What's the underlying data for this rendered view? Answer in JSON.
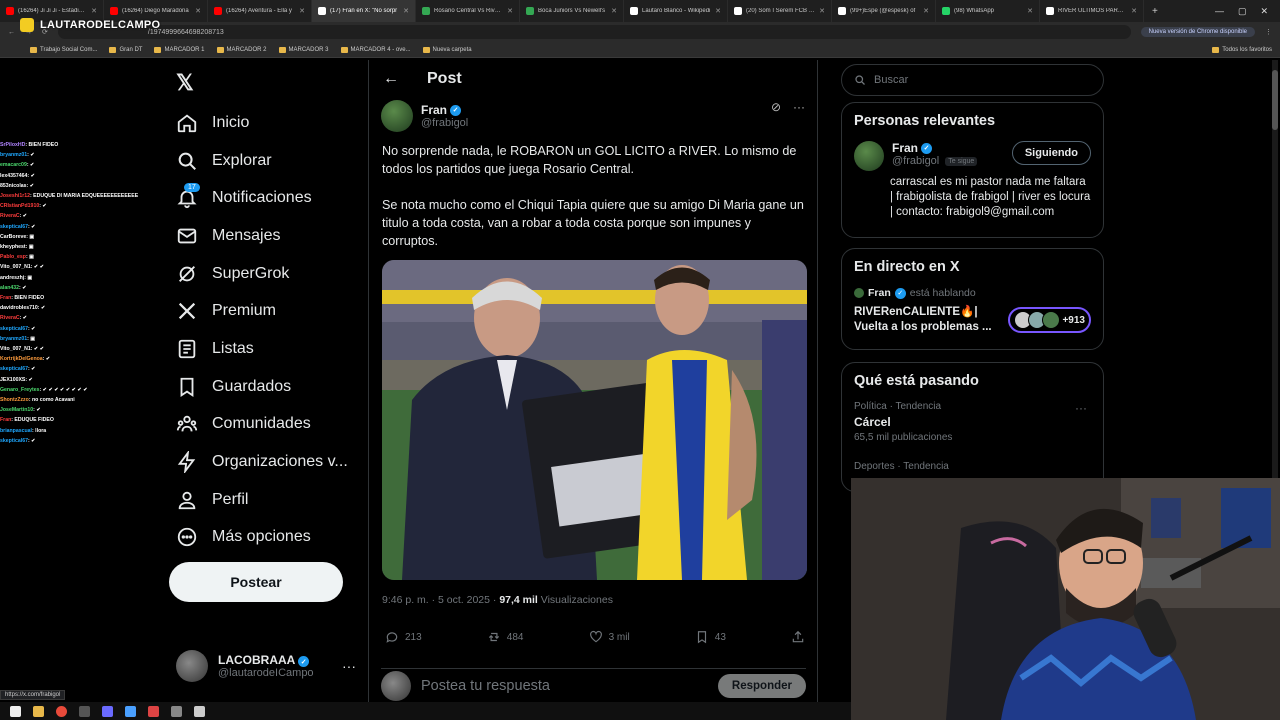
{
  "browser": {
    "tabs": [
      {
        "label": "(16264) Ji Ji Ji - Estadio U",
        "color": "#ff0000"
      },
      {
        "label": "(16264) Diego Maradona",
        "color": "#ff0000"
      },
      {
        "label": "(16264) Aventura - Ella y",
        "color": "#ff0000"
      },
      {
        "label": "(17) Fran en X: \"No sorpr",
        "color": "#ffffff",
        "active": true
      },
      {
        "label": "Rosario Central Vs River P",
        "color": "#34a853"
      },
      {
        "label": "Boca Juniors Vs Newell's",
        "color": "#34a853"
      },
      {
        "label": "Lautaro Blanco - Wikipedi",
        "color": "#ffffff"
      },
      {
        "label": "(20) Som I Serem FCB en",
        "color": "#ffffff"
      },
      {
        "label": "(99+)Espe (@espesk) of",
        "color": "#ffffff"
      },
      {
        "label": "(98) WhatsApp",
        "color": "#25d366"
      },
      {
        "label": "RIVER ULTIMOS PARTIDO",
        "color": "#ffffff"
      }
    ],
    "url": "/1974999664698208713",
    "chrome_update": "Nueva versión de Chrome disponible",
    "bookmarks": [
      "Trabajo Social Com...",
      "Gran DT",
      "MARCADOR 1",
      "MARCADOR 2",
      "MARCADOR 3",
      "MARCADOR 4 - ove...",
      "Nueva carpeta"
    ],
    "bookmarks_right": "Todos los favoritos",
    "status_url": "https://x.com/frabigol"
  },
  "overlay": {
    "logo": "LAUTARODELCAMPO"
  },
  "chat": [
    {
      "user": "SrPiloxHD",
      "msg": ": BIEN FIDEO",
      "color": "#b084ff"
    },
    {
      "user": "bryanmz01",
      "msg": ": ✔",
      "color": "#1fa8ff"
    },
    {
      "user": "emacarc09",
      "msg": ": ✔",
      "color": "#4cd96e"
    },
    {
      "user": "lex4357464",
      "msg": ": ✔",
      "color": "#ffffff"
    },
    {
      "user": "853nicolas",
      "msg": ": ✔",
      "color": "#ffffff"
    },
    {
      "user": "Joseshi1r12",
      "msg": ": EDUQUE DI MARIA EDQUEEEEEEEEEEEE",
      "color": "#ff3d3d"
    },
    {
      "user": "CRIstianPd1910",
      "msg": ": ✔",
      "color": "#ff3d3d"
    },
    {
      "user": "RiveraC",
      "msg": ": ✔",
      "color": "#ff3d3d"
    },
    {
      "user": "skeptical67",
      "msg": ": ✔",
      "color": "#1fa8ff"
    },
    {
      "user": "CarBoreve",
      "msg": ": ▣",
      "color": "#ffffff"
    },
    {
      "user": "kheyphest",
      "msg": ": ▣",
      "color": "#ffffff"
    },
    {
      "user": "Pablo_esp",
      "msg": ": ▣",
      "color": "#ff3d3d"
    },
    {
      "user": "Vito_007_N1",
      "msg": ": ✔ ✔",
      "color": "#ffffff"
    },
    {
      "user": "andreszhj",
      "msg": ": ▣",
      "color": "#ffffff"
    },
    {
      "user": "alan432",
      "msg": ": ✔",
      "color": "#4cd96e"
    },
    {
      "user": "Fran",
      "msg": ": BIEN FIDEO",
      "color": "#ff3d3d"
    },
    {
      "user": "davidrobles710",
      "msg": ": ✔",
      "color": "#ffffff"
    },
    {
      "user": "RiveraC",
      "msg": ": ✔",
      "color": "#ff3d3d"
    },
    {
      "user": "skeptical67",
      "msg": ": ✔",
      "color": "#1fa8ff"
    },
    {
      "user": "bryanmz01",
      "msg": ": ▣",
      "color": "#1fa8ff"
    },
    {
      "user": "Vito_007_N1",
      "msg": ": ✔ ✔",
      "color": "#ffffff"
    },
    {
      "user": "KortrijkDelGenoa",
      "msg": ": ✔",
      "color": "#ff9c3d"
    },
    {
      "user": "skeptical67",
      "msg": ": ✔",
      "color": "#1fa8ff"
    },
    {
      "user": "JEX100XS",
      "msg": ": ✔",
      "color": "#ffffff"
    },
    {
      "user": "Genaro_Freytes",
      "msg": ": ✔ ✔ ✔ ✔ ✔ ✔ ✔ ✔",
      "color": "#4cd96e"
    },
    {
      "user": "ShontzZzzo",
      "msg": ": no como Acavani",
      "color": "#ff9c3d"
    },
    {
      "user": "JoseMartin10",
      "msg": ": ✔",
      "color": "#4cd96e"
    },
    {
      "user": "Fran",
      "msg": ": EDUQUE FIDEO",
      "color": "#ff3d3d"
    },
    {
      "user": "brianpascual",
      "msg": ": llora",
      "color": "#1fa8ff"
    },
    {
      "user": "skeptical67",
      "msg": ": ✔",
      "color": "#1fa8ff"
    }
  ],
  "nav": {
    "items": [
      "Inicio",
      "Explorar",
      "Notificaciones",
      "Mensajes",
      "SuperGrok",
      "Premium",
      "Listas",
      "Guardados",
      "Comunidades",
      "Organizaciones v...",
      "Perfil",
      "Más opciones"
    ],
    "notif_badge": "17",
    "post_button": "Postear",
    "account_name": "LACOBRAAA",
    "account_handle": "@lautarodeICampo"
  },
  "post": {
    "header": "Post",
    "author_name": "Fran",
    "author_handle": "@frabigol",
    "paragraph1": "No sorprende nada, le ROBARON un GOL LICITO a RIVER. Lo mismo de todos los partidos que juega Rosario Central.",
    "paragraph2": "Se nota mucho como el Chiqui Tapia quiere que su amigo Di Maria gane un titulo a toda costa, van a robar a toda costa porque son impunes y corruptos.",
    "time": "9:46 p. m. · 5 oct. 2025 · ",
    "views": "97,4 mil",
    "views_label": " Visualizaciones",
    "replies": "213",
    "reposts": "484",
    "likes": "3 mil",
    "bookmarks": "43",
    "reply_placeholder": "Postea tu respuesta",
    "reply_button": "Responder"
  },
  "sidebar": {
    "search_placeholder": "Buscar",
    "relevant_title": "Personas relevantes",
    "rel_name": "Fran",
    "rel_handle": "@frabigol",
    "rel_tag": "Te sigue",
    "rel_button": "Siguiendo",
    "rel_bio": "carrascal es mi pastor nada me faltara | frabigolista de frabigol | river es locura | contacto: frabigol9@gmail.com",
    "live_title": "En directo en X",
    "live_host": "Fran",
    "live_host_suffix": "está hablando",
    "live_space": "RIVERenCALIENTE🔥| Vuelta a los problemas ...",
    "live_count": "+913",
    "trending_title": "Qué está pasando",
    "trend1_cat": "Política · Tendencia",
    "trend1_name": "Cárcel",
    "trend1_count": "65,5 mil publicaciones",
    "trend2_cat": "Deportes · Tendencia"
  }
}
